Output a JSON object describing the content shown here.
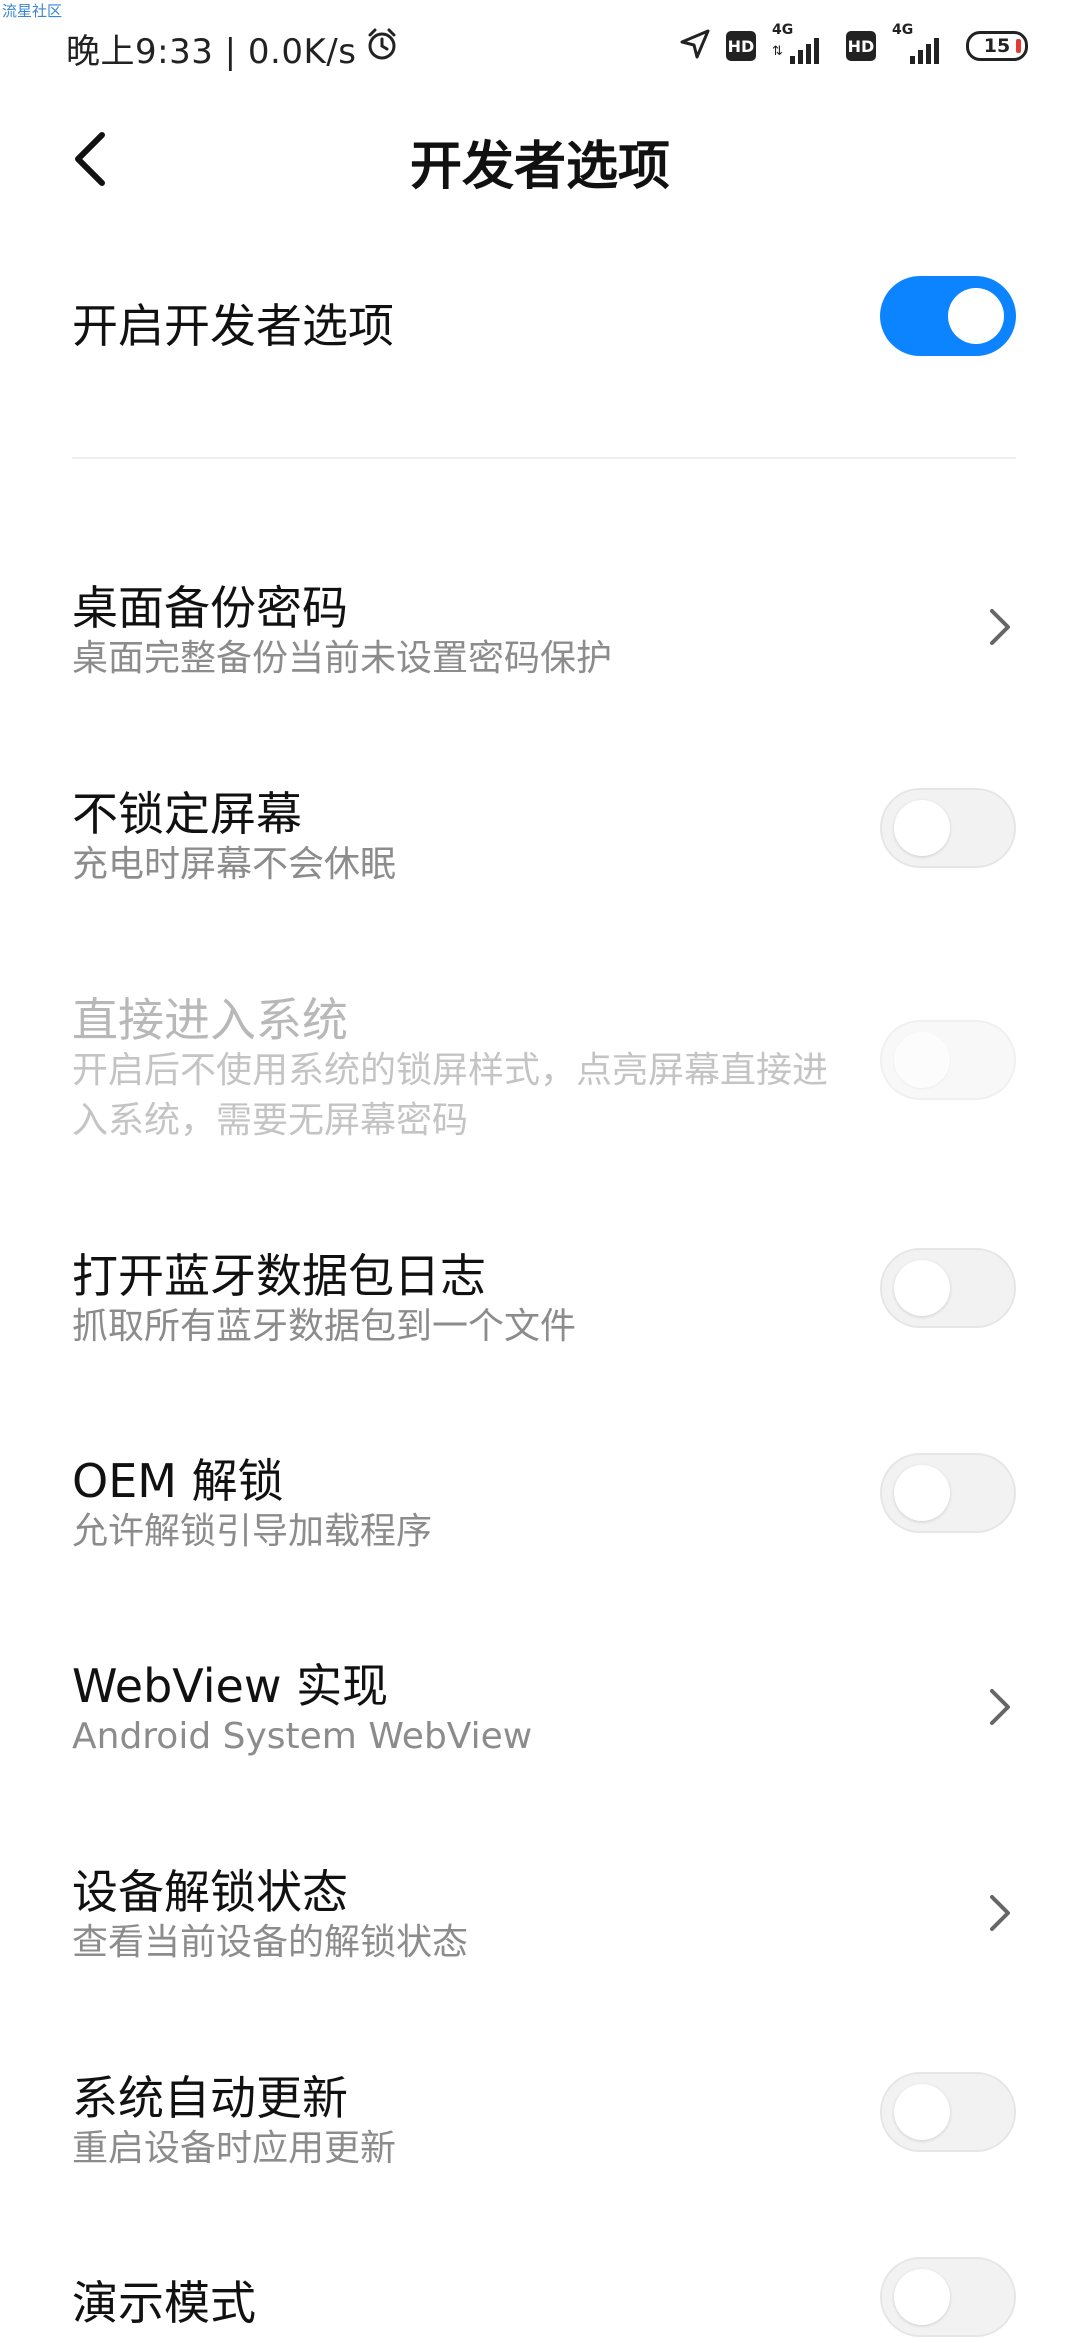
{
  "watermark": "流星社区",
  "status_bar": {
    "time_speed": "晚上9:33 | 0.0K/s",
    "alarm_icon": "alarm-clock-icon",
    "location_icon": "navigation-arrow-icon",
    "hd_label": "HD",
    "network_type": "4G",
    "battery_level": "15",
    "battery_color": "#e53935"
  },
  "header": {
    "back_icon": "chevron-left-icon",
    "title": "开发者选项"
  },
  "master_toggle": {
    "label": "开启开发者选项",
    "enabled": true,
    "accent_color": "#0d84ff"
  },
  "items": [
    {
      "title": "桌面备份密码",
      "subtitle": "桌面完整备份当前未设置密码保护",
      "control": "chevron"
    },
    {
      "title": "不锁定屏幕",
      "subtitle": "充电时屏幕不会休眠",
      "control": "switch",
      "enabled": false
    },
    {
      "title": "直接进入系统",
      "subtitle": "开启后不使用系统的锁屏样式，点亮屏幕直接进入系统，需要无屏幕密码",
      "control": "switch",
      "enabled": false,
      "disabled": true
    },
    {
      "title": "打开蓝牙数据包日志",
      "subtitle": "抓取所有蓝牙数据包到一个文件",
      "control": "switch",
      "enabled": false
    },
    {
      "title": "OEM 解锁",
      "subtitle": "允许解锁引导加载程序",
      "control": "switch",
      "enabled": false
    },
    {
      "title": "WebView 实现",
      "subtitle": "Android System WebView",
      "control": "chevron"
    },
    {
      "title": "设备解锁状态",
      "subtitle": "查看当前设备的解锁状态",
      "control": "chevron"
    },
    {
      "title": "系统自动更新",
      "subtitle": "重启设备时应用更新",
      "control": "switch",
      "enabled": false
    },
    {
      "title": "演示模式",
      "subtitle": "",
      "control": "switch",
      "enabled": false
    }
  ]
}
